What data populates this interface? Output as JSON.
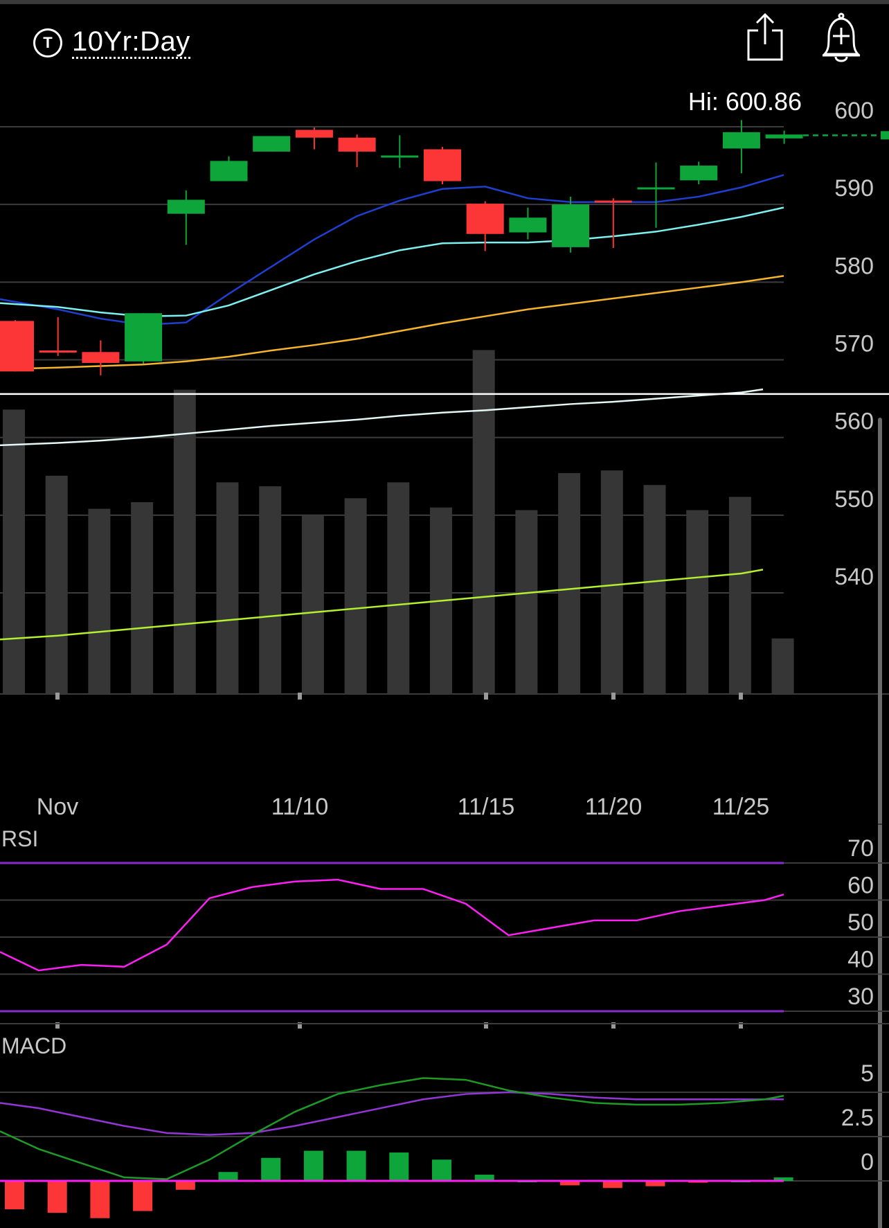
{
  "header": {
    "symbol_icon": "T",
    "title": "10Yr:Day",
    "share_icon": "share-icon",
    "alert_icon": "add-alert-bell-icon"
  },
  "price_panel": {
    "hi_label": "Hi: 600.86",
    "y_ticks": [
      600,
      590,
      580,
      570,
      560,
      550,
      540
    ],
    "ylim": [
      527,
      601.5
    ]
  },
  "x_axis": {
    "labels": [
      {
        "text": "Nov",
        "day": 0
      },
      {
        "text": "11/10",
        "day": 6
      },
      {
        "text": "11/15",
        "day": 10
      },
      {
        "text": "11/20",
        "day": 13
      },
      {
        "text": "11/25",
        "day": 16
      }
    ]
  },
  "chart_data": [
    {
      "type": "candlestick",
      "panel": "price",
      "dates": [
        "Nov",
        "",
        "",
        "",
        "",
        "",
        "11/10",
        "",
        "",
        "",
        "11/15",
        "",
        "",
        "11/20",
        "",
        "",
        "11/25",
        "",
        ""
      ],
      "candles": [
        {
          "o": 575.0,
          "h": 575.1,
          "l": 568.5,
          "c": 568.5
        },
        {
          "o": 571.2,
          "h": 575.5,
          "l": 570.5,
          "c": 571.0
        },
        {
          "o": 571.0,
          "h": 572.5,
          "l": 568.0,
          "c": 569.6
        },
        {
          "o": 569.8,
          "h": 576.0,
          "l": 569.5,
          "c": 576.0
        },
        {
          "o": 588.8,
          "h": 591.8,
          "l": 584.8,
          "c": 590.6
        },
        {
          "o": 593.0,
          "h": 596.2,
          "l": 593.0,
          "c": 595.6
        },
        {
          "o": 596.8,
          "h": 598.8,
          "l": 596.8,
          "c": 598.8
        },
        {
          "o": 599.6,
          "h": 599.9,
          "l": 597.1,
          "c": 598.6
        },
        {
          "o": 598.6,
          "h": 599.0,
          "l": 594.8,
          "c": 596.8
        },
        {
          "o": 596.3,
          "h": 598.9,
          "l": 594.7,
          "c": 596.3
        },
        {
          "o": 597.1,
          "h": 597.4,
          "l": 592.6,
          "c": 593.0
        },
        {
          "o": 590.1,
          "h": 590.4,
          "l": 584.0,
          "c": 586.2
        },
        {
          "o": 586.4,
          "h": 589.6,
          "l": 585.5,
          "c": 588.3
        },
        {
          "o": 584.5,
          "h": 591.0,
          "l": 583.8,
          "c": 590.0
        },
        {
          "o": 590.5,
          "h": 590.8,
          "l": 584.4,
          "c": 590.3
        },
        {
          "o": 592.1,
          "h": 595.4,
          "l": 587.0,
          "c": 592.2
        },
        {
          "o": 593.1,
          "h": 595.5,
          "l": 592.6,
          "c": 595.0
        },
        {
          "o": 597.2,
          "h": 600.86,
          "l": 594.0,
          "c": 599.3
        },
        {
          "o": 598.5,
          "h": 599.5,
          "l": 597.8,
          "c": 599.0
        }
      ],
      "volume_bars": [
        21.5,
        16.5,
        14.0,
        14.5,
        23.0,
        16.0,
        15.7,
        13.5,
        14.8,
        16.0,
        14.1,
        26.0,
        13.9,
        16.7,
        16.9,
        15.8,
        13.9,
        14.9,
        4.2
      ],
      "moving_averages": [
        {
          "color": "#1f3fd0",
          "values": [
            577.8,
            576.5,
            575.3,
            574.5,
            574.8,
            578.5,
            582.0,
            585.5,
            588.5,
            590.5,
            592.0,
            592.3,
            590.8,
            590.3,
            590.3,
            590.3,
            591.0,
            592.2,
            593.8
          ]
        },
        {
          "color": "#7ef0f0",
          "values": [
            577.3,
            576.8,
            576.1,
            575.6,
            575.7,
            577.0,
            579.0,
            581.0,
            582.7,
            584.1,
            585.0,
            585.1,
            585.1,
            585.4,
            585.9,
            586.5,
            587.4,
            588.4,
            589.6
          ]
        },
        {
          "color": "#f6b42c",
          "values": [
            568.8,
            569.0,
            569.2,
            569.4,
            569.8,
            570.4,
            571.2,
            571.9,
            572.7,
            573.7,
            574.7,
            575.6,
            576.5,
            577.2,
            577.9,
            578.6,
            579.3,
            580.0,
            580.8
          ]
        },
        {
          "color": "#e4f6f6",
          "values": [
            559.0,
            559.3,
            559.6,
            560.0,
            560.5,
            561.0,
            561.5,
            561.9,
            562.3,
            562.8,
            563.2,
            563.5,
            563.9,
            564.3,
            564.6,
            565.0,
            565.4,
            565.8,
            566.2
          ]
        },
        {
          "color": "#b4f030",
          "values": [
            534.0,
            534.5,
            535.0,
            535.5,
            536.0,
            536.5,
            537.0,
            537.5,
            538.0,
            538.5,
            539.0,
            539.5,
            540.0,
            540.5,
            541.0,
            541.5,
            542.0,
            542.5,
            543.0
          ]
        }
      ],
      "reference_line": 565.6,
      "last_price_line": 598.9
    },
    {
      "type": "line",
      "panel": "RSI",
      "title": "RSI",
      "y_ticks": [
        70,
        60,
        50,
        40,
        30
      ],
      "bands": [
        70,
        30
      ],
      "values": [
        46,
        41,
        42.5,
        42,
        48,
        60.5,
        63.5,
        65,
        65.5,
        63,
        63,
        59,
        50.5,
        52.5,
        54.5,
        54.5,
        57,
        58.5,
        60,
        61.5
      ]
    },
    {
      "type": "line+bar",
      "panel": "MACD",
      "title": "MACD",
      "y_ticks": [
        5,
        2.5,
        0
      ],
      "macd": [
        2.8,
        1.8,
        1.0,
        0.2,
        0.1,
        1.2,
        2.6,
        3.9,
        4.9,
        5.4,
        5.8,
        5.7,
        5.1,
        4.7,
        4.4,
        4.3,
        4.3,
        4.4,
        4.6,
        4.8
      ],
      "signal": [
        4.4,
        4.1,
        3.6,
        3.1,
        2.7,
        2.6,
        2.7,
        3.1,
        3.6,
        4.1,
        4.6,
        4.9,
        5.0,
        4.9,
        4.7,
        4.6,
        4.6,
        4.6,
        4.6,
        4.6
      ],
      "histogram": [
        -1.6,
        -1.8,
        -2.1,
        -1.7,
        -0.5,
        0.5,
        1.3,
        1.7,
        1.7,
        1.6,
        1.2,
        0.35,
        0.0,
        -0.25,
        -0.4,
        -0.3,
        -0.1,
        0.0,
        0.2
      ]
    }
  ],
  "colors": {
    "up": "#0ea63a",
    "down": "#fc3636",
    "volume": "#363636",
    "grid": "#3c3c3c",
    "rsi_line": "#ff1ff5",
    "rsi_band": "#8a2bd0",
    "macd_line": "#1d9b26",
    "signal_line": "#9435d6",
    "zero_line": "#ff1ff5"
  }
}
